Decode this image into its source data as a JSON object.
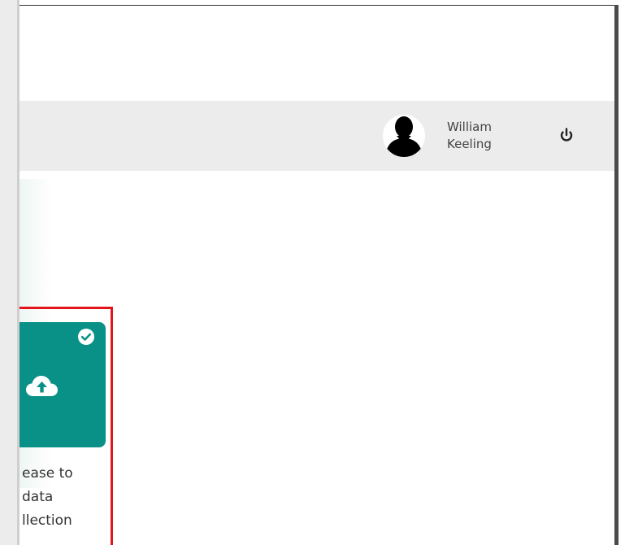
{
  "header": {
    "user": {
      "first_name": "William",
      "last_name": "Keeling"
    },
    "power_icon": "power-icon",
    "avatar_icon": "user-silhouette-icon"
  },
  "card": {
    "icon": "cloud-upload-icon",
    "badge_icon": "check-circle-icon",
    "label_lines": [
      "ease to",
      "data",
      "llection"
    ],
    "selected": true,
    "color": "#0a9187",
    "highlight_color": "#e3151b"
  }
}
